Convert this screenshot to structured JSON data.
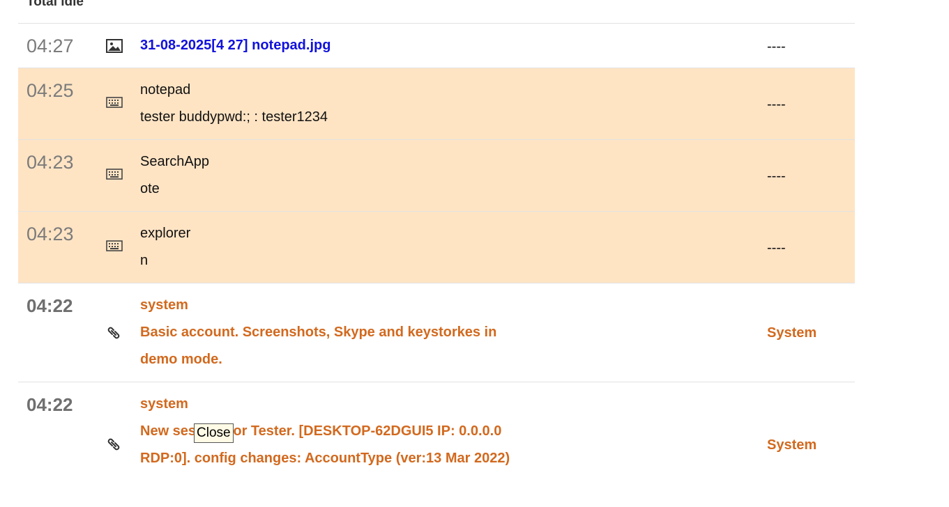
{
  "header": {
    "label": "Total idle"
  },
  "rows": [
    {
      "time": "04:27",
      "icon": "image-icon",
      "title": "31-08-2025[4 27] notepad.jpg",
      "detail": "",
      "status": "----"
    },
    {
      "time": "04:25",
      "icon": "keyboard-icon",
      "title": "notepad",
      "detail": "tester buddypwd:; : tester1234",
      "status": "----"
    },
    {
      "time": "04:23",
      "icon": "keyboard-icon",
      "title": "SearchApp",
      "detail": "ote",
      "status": "----"
    },
    {
      "time": "04:23",
      "icon": "keyboard-icon",
      "title": "explorer",
      "detail": "n",
      "status": "----"
    },
    {
      "time": "04:22",
      "icon": "link-icon",
      "title": "system",
      "detail": "Basic account. Screenshots, Skype and keystorkes in demo mode.",
      "status": "System"
    },
    {
      "time": "04:22",
      "icon": "link-icon",
      "title": "system",
      "detail": "New session for Tester. [DESKTOP-62DGUI5 IP: 0.0.0.0 RDP:0]. config changes: AccountType (ver:13 Mar 2022)",
      "status": "System"
    }
  ],
  "tooltip": {
    "text": "Close"
  },
  "colors": {
    "keystroke_row_bg": "#ffe4c4",
    "system_text": "#d2691e",
    "file_link": "#1111dd"
  }
}
